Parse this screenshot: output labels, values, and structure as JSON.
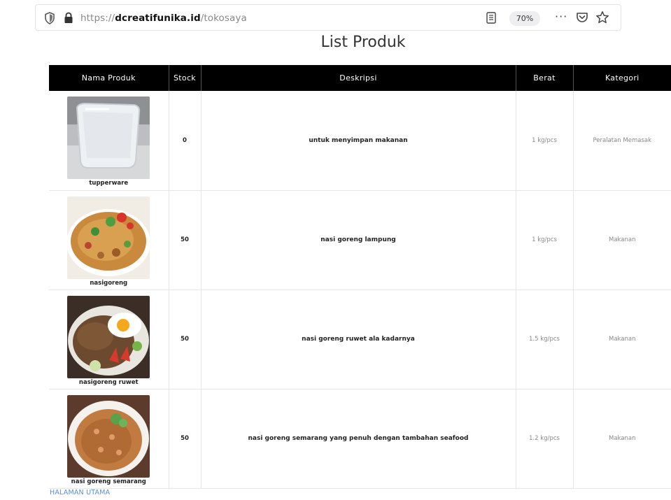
{
  "browser": {
    "url_prefix": "https://",
    "url_host": "dcreatifunika.id",
    "url_path": "/tokosaya",
    "zoom": "70%",
    "more_label": "···"
  },
  "page": {
    "title": "List Produk",
    "footer_link": "HALAMAN UTAMA"
  },
  "table": {
    "columns": [
      "Nama Produk",
      "Stock",
      "Deskripsi",
      "Berat",
      "Kategori"
    ],
    "rows": [
      {
        "name": "tupperware",
        "stock": "0",
        "description": "untuk menyimpan makanan",
        "weight": "1 kg/pcs",
        "category": "Peralatan Memasak",
        "image": "plastic-container-photo"
      },
      {
        "name": "nasigoreng",
        "stock": "50",
        "description": "nasi goreng lampung",
        "weight": "1 kg/pcs",
        "category": "Makanan",
        "image": "fried-rice-photo"
      },
      {
        "name": "nasigoreng ruwet",
        "stock": "50",
        "description": "nasi goreng ruwet ala kadarnya",
        "weight": "1.5 kg/pcs",
        "category": "Makanan",
        "image": "fried-rice-egg-photo"
      },
      {
        "name": "nasi goreng semarang",
        "stock": "50",
        "description": "nasi goreng semarang yang penuh dengan tambahan seafood",
        "weight": "1.2 kg/pcs",
        "category": "Makanan",
        "image": "seafood-fried-rice-photo"
      }
    ]
  },
  "colors": {
    "table_header_bg": "#000000",
    "link": "#5d8fc6"
  }
}
